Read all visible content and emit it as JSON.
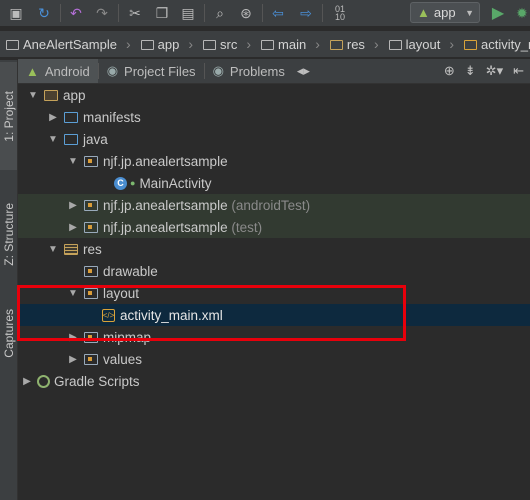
{
  "toolbar": {
    "run_config": "app",
    "icons": [
      "save-icon",
      "sync-icon",
      "undo-icon",
      "redo-icon",
      "cut-icon",
      "copy-icon",
      "paste-icon",
      "find-icon",
      "replace-icon",
      "back-icon",
      "forward-icon",
      "make-icon",
      "android-icon",
      "run-icon",
      "debug-icon"
    ]
  },
  "breadcrumb": {
    "items": [
      "AneAlertSample",
      "app",
      "src",
      "main",
      "res",
      "layout",
      "activity_main.xml"
    ]
  },
  "sidebar": {
    "tabs": [
      "1: Project",
      "Z: Structure",
      "Captures"
    ]
  },
  "panel": {
    "tabs": [
      "Android",
      "Project Files",
      "Problems"
    ]
  },
  "tree": {
    "app": "app",
    "manifests": "manifests",
    "java": "java",
    "pkg_main": "njf.jp.anealertsample",
    "main_activity": "MainActivity",
    "pkg_android_test": "njf.jp.anealertsample",
    "android_test_suffix": "(androidTest)",
    "pkg_test": "njf.jp.anealertsample",
    "test_suffix": "(test)",
    "res": "res",
    "drawable": "drawable",
    "layout": "layout",
    "activity_main": "activity_main.xml",
    "mipmap": "mipmap",
    "values": "values",
    "gradle_scripts": "Gradle Scripts"
  },
  "colors": {
    "highlight_box": "#e8000b",
    "selection": "#0d293e"
  }
}
